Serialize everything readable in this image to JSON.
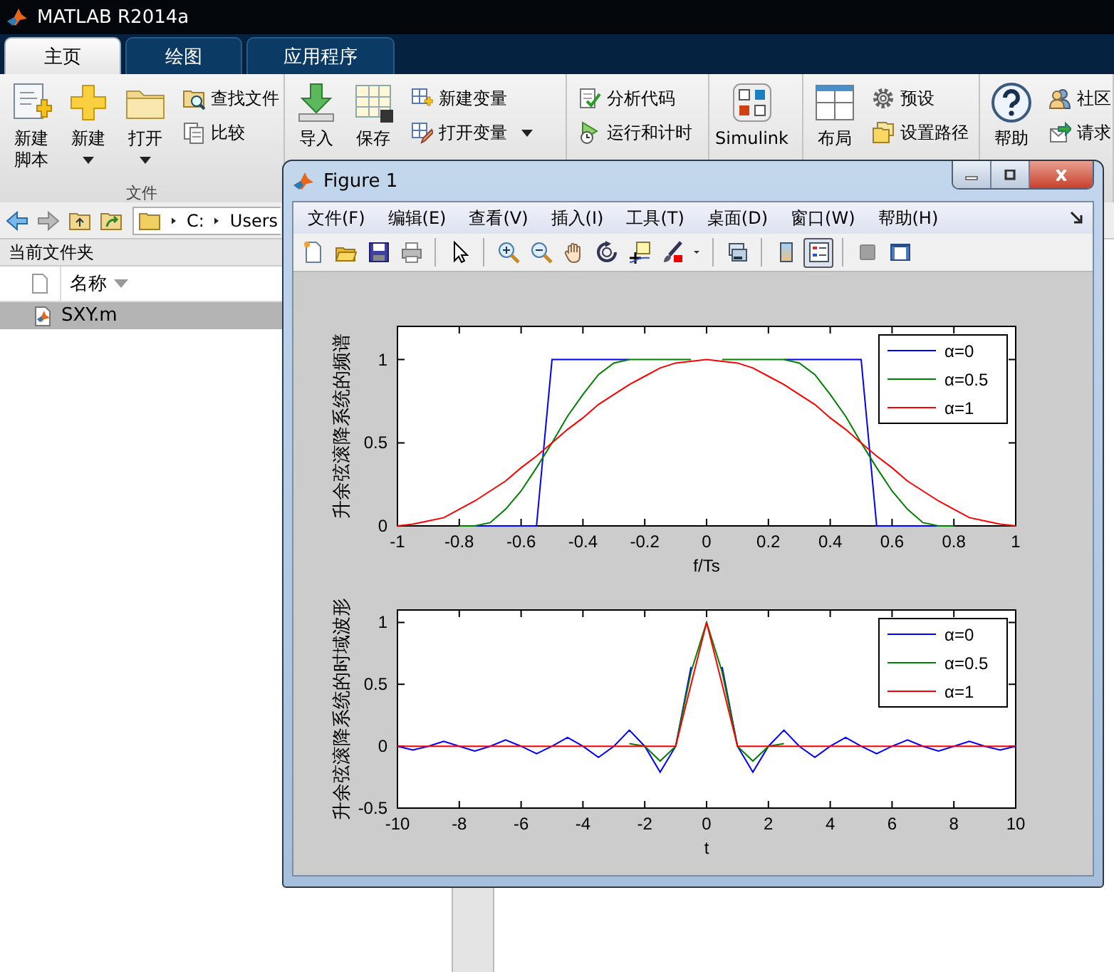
{
  "window": {
    "title": "MATLAB R2014a"
  },
  "tabs": [
    {
      "label": "主页",
      "selected": true
    },
    {
      "label": "绘图",
      "selected": false
    },
    {
      "label": "应用程序",
      "selected": false
    }
  ],
  "toolstrip": {
    "groups": [
      {
        "label": "文件",
        "items": [
          {
            "kind": "big",
            "label": "新建脚本",
            "dropdown": false
          },
          {
            "kind": "big",
            "label": "新建",
            "dropdown": true
          },
          {
            "kind": "big",
            "label": "打开",
            "dropdown": true
          },
          {
            "kind": "small",
            "label": "查找文件",
            "dropdown": false
          },
          {
            "kind": "small",
            "label": "比较",
            "dropdown": false
          }
        ]
      },
      {
        "items": [
          {
            "kind": "big",
            "label": "导入",
            "dropdown": false
          },
          {
            "kind": "big",
            "label": "保存"
          },
          {
            "kind": "small",
            "label": "新建变量",
            "dropdown": false
          },
          {
            "kind": "small",
            "label": "打开变量",
            "dropdown": true
          }
        ]
      },
      {
        "items": [
          {
            "kind": "small",
            "label": "分析代码",
            "dropdown": false
          },
          {
            "kind": "small",
            "label": "运行和计时",
            "dropdown": false
          }
        ]
      },
      {
        "items": [
          {
            "kind": "big",
            "label": "Simulink",
            "dropdown": false
          }
        ]
      },
      {
        "items": [
          {
            "kind": "big",
            "label": "布局"
          },
          {
            "kind": "small",
            "label": "预设",
            "dropdown": false
          },
          {
            "kind": "small",
            "label": "设置路径",
            "dropdown": false
          }
        ]
      },
      {
        "items": [
          {
            "kind": "big",
            "label": "帮助",
            "dropdown": false
          },
          {
            "kind": "small",
            "label": "社区"
          },
          {
            "kind": "small",
            "label": "请求"
          }
        ]
      }
    ]
  },
  "address_bar": {
    "path": [
      "C:",
      "Users"
    ]
  },
  "current_folder": {
    "title": "当前文件夹",
    "column": "名称",
    "files": [
      {
        "name": "SXY.m",
        "selected": true
      }
    ]
  },
  "figure": {
    "title": "Figure 1",
    "menu": [
      "文件(F)",
      "编辑(E)",
      "查看(V)",
      "插入(I)",
      "工具(T)",
      "桌面(D)",
      "窗口(W)",
      "帮助(H)"
    ],
    "toolbar": {
      "legend_button": {
        "pressed": true
      }
    },
    "plots": [
      {
        "chart_data": {
          "type": "line",
          "xlabel": "f/Ts",
          "ylabel": "升余弦滚降系统的频谱",
          "x": [
            -1,
            -0.95,
            -0.9,
            -0.85,
            -0.8,
            -0.75,
            -0.7,
            -0.65,
            -0.6,
            -0.55,
            -0.5,
            -0.45,
            -0.4,
            -0.35,
            -0.3,
            -0.25,
            -0.2,
            -0.15,
            -0.1,
            -0.05,
            0,
            0.05,
            0.1,
            0.15,
            0.2,
            0.25,
            0.3,
            0.35,
            0.4,
            0.45,
            0.5,
            0.55,
            0.6,
            0.65,
            0.7,
            0.75,
            0.8,
            0.85,
            0.9,
            0.95,
            1
          ],
          "series": [
            {
              "name": "α=0",
              "color": "#0000ff",
              "values": [
                null,
                null,
                null,
                null,
                null,
                0,
                0,
                0,
                0,
                0,
                1,
                1,
                1,
                1,
                1,
                1,
                null,
                null,
                null,
                null,
                null,
                null,
                null,
                null,
                null,
                1,
                1,
                1,
                1,
                1,
                1,
                0,
                0,
                0,
                0,
                0,
                null,
                null,
                null,
                null,
                null
              ]
            },
            {
              "name": "α=0.5",
              "color": "#008000",
              "values": [
                null,
                null,
                null,
                null,
                0,
                0,
                0.02,
                0.1,
                0.21,
                0.35,
                0.5,
                0.66,
                0.79,
                0.91,
                0.98,
                1,
                1,
                1,
                1,
                1,
                null,
                1,
                1,
                1,
                1,
                1,
                0.98,
                0.91,
                0.79,
                0.66,
                0.5,
                0.35,
                0.21,
                0.1,
                0.02,
                0,
                0,
                null,
                null,
                null,
                null
              ]
            },
            {
              "name": "α=1",
              "color": "#ff0000",
              "values": [
                0,
                0.01,
                0.03,
                0.05,
                0.1,
                0.15,
                0.21,
                0.27,
                0.35,
                0.42,
                0.5,
                0.58,
                0.65,
                0.73,
                0.79,
                0.85,
                0.9,
                0.95,
                0.98,
                0.99,
                1,
                0.99,
                0.98,
                0.95,
                0.9,
                0.85,
                0.79,
                0.73,
                0.65,
                0.58,
                0.5,
                0.42,
                0.35,
                0.27,
                0.21,
                0.15,
                0.1,
                0.05,
                0.03,
                0.01,
                0
              ]
            }
          ],
          "xlim": [
            -1,
            1
          ],
          "ylim": [
            0,
            1.2
          ],
          "xticks": [
            -1,
            -0.8,
            -0.6,
            -0.4,
            -0.2,
            0,
            0.2,
            0.4,
            0.6,
            0.8,
            1
          ],
          "yticks": [
            0,
            0.5,
            1
          ],
          "legend": "upper right"
        }
      },
      {
        "chart_data": {
          "type": "line",
          "xlabel": "t",
          "ylabel": "升余弦滚降系统的时域波形",
          "x": [
            -10,
            -9.5,
            -9,
            -8.5,
            -8,
            -7.5,
            -7,
            -6.5,
            -6,
            -5.5,
            -5,
            -4.5,
            -4,
            -3.5,
            -3,
            -2.5,
            -2,
            -1.5,
            -1,
            -0.5,
            0,
            0.5,
            1,
            1.5,
            2,
            2.5,
            3,
            3.5,
            4,
            4.5,
            5,
            5.5,
            6,
            6.5,
            7,
            7.5,
            8,
            8.5,
            9,
            9.5,
            10
          ],
          "series": [
            {
              "name": "α=0",
              "color": "#0000ff",
              "values": [
                0,
                -0.03,
                0,
                0.04,
                0,
                -0.04,
                0,
                0.05,
                0,
                -0.06,
                0,
                0.07,
                0,
                -0.09,
                0,
                0.13,
                0,
                -0.21,
                0,
                0.64,
                null,
                0.64,
                0,
                -0.21,
                0,
                0.13,
                0,
                -0.09,
                0,
                0.07,
                0,
                -0.06,
                0,
                0.05,
                0,
                -0.04,
                0,
                0.04,
                0,
                -0.03,
                0
              ]
            },
            {
              "name": "α=0.5",
              "color": "#008000",
              "values": [
                null,
                null,
                null,
                null,
                null,
                null,
                null,
                null,
                null,
                null,
                null,
                null,
                null,
                null,
                null,
                0.02,
                0,
                -0.12,
                0,
                0.6,
                1,
                0.6,
                0,
                -0.12,
                0,
                0.02,
                null,
                null,
                null,
                null,
                null,
                null,
                null,
                null,
                null,
                null,
                null,
                null,
                null,
                null,
                null
              ]
            },
            {
              "name": "α=1",
              "color": "#ff0000",
              "values": [
                0,
                0,
                0,
                0,
                0,
                0,
                0,
                0,
                0,
                0,
                0,
                0,
                0,
                0,
                0,
                0,
                0,
                0,
                0,
                0.5,
                1,
                0.5,
                0,
                0,
                0,
                0,
                0,
                0,
                0,
                0,
                0,
                0,
                0,
                0,
                0,
                0,
                0,
                0,
                0,
                0,
                0
              ]
            }
          ],
          "xlim": [
            -10,
            10
          ],
          "ylim": [
            -0.5,
            1.1
          ],
          "xticks": [
            -10,
            -8,
            -6,
            -4,
            -2,
            0,
            2,
            4,
            6,
            8,
            10
          ],
          "yticks": [
            -0.5,
            0,
            0.5,
            1
          ],
          "legend": "upper right"
        }
      }
    ]
  }
}
